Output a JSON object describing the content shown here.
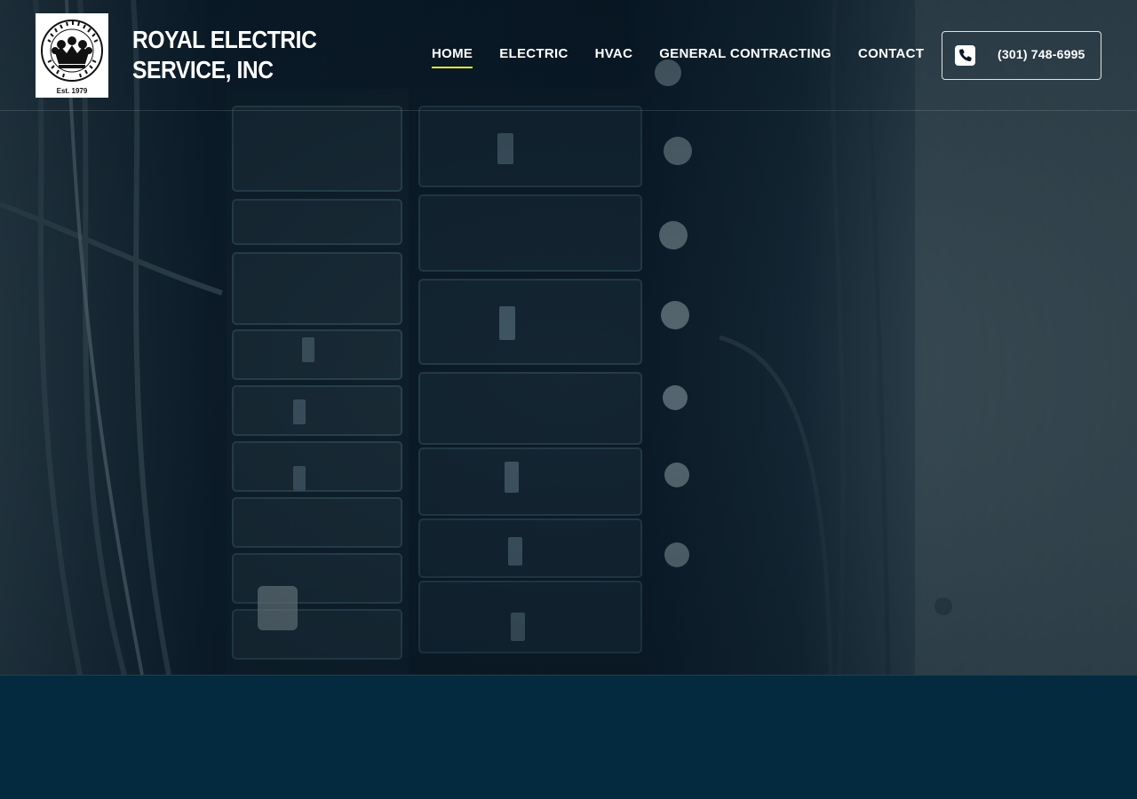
{
  "brand": {
    "name": "ROYAL ELECTRIC SERVICE, INC",
    "logo_text_top": "ROYAL ELECTRICAL SERVICES, INC.",
    "logo_est": "Est. 1979"
  },
  "nav": {
    "items": [
      {
        "label": "HOME",
        "active": true
      },
      {
        "label": "ELECTRIC",
        "active": false
      },
      {
        "label": "HVAC",
        "active": false
      },
      {
        "label": "GENERAL CONTRACTING",
        "active": false
      },
      {
        "label": "CONTACT",
        "active": false
      }
    ]
  },
  "phone": {
    "number": "(301) 748-6995",
    "icon": "phone-icon"
  },
  "hero": {
    "image": "electrical-breaker-panel-photo"
  },
  "colors": {
    "accent_underline": "#e8e22a",
    "lower_background": "#042a40",
    "text": "#ffffff"
  }
}
